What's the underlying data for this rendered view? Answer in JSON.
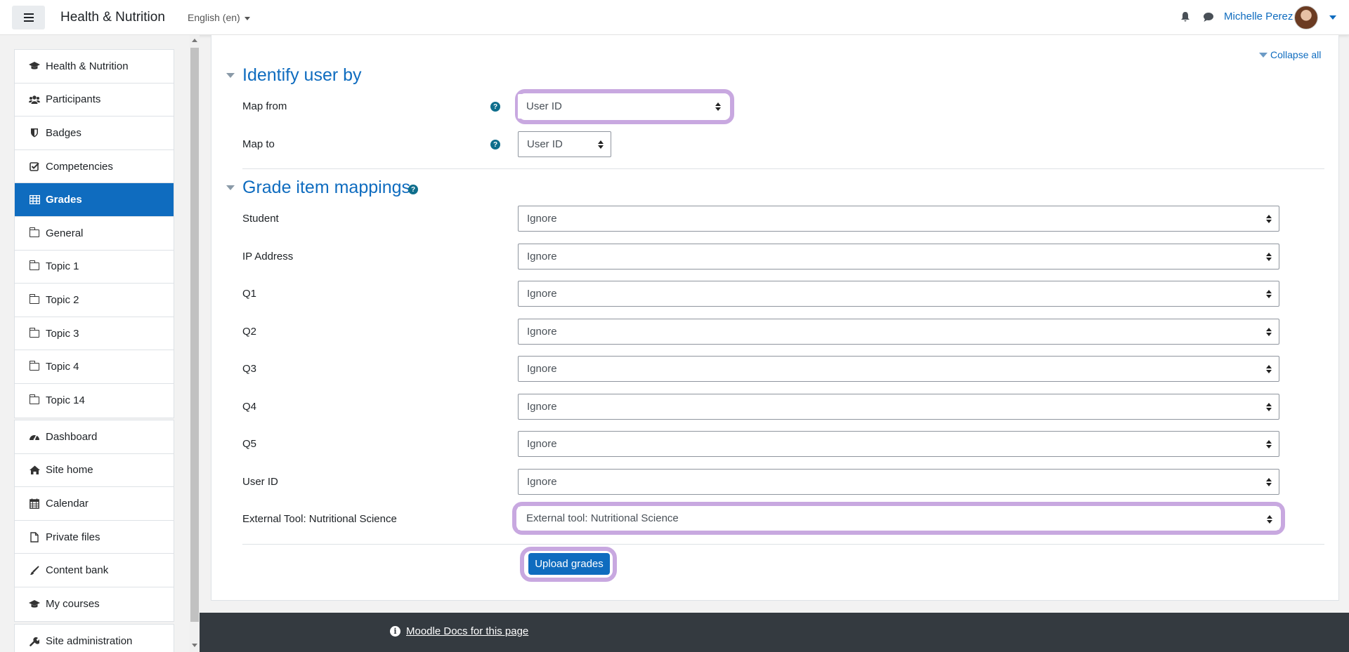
{
  "navbar": {
    "site_name": "Health & Nutrition",
    "language": "English (en)",
    "user_name": "Michelle Perez"
  },
  "sidebar": {
    "course_items": [
      {
        "label": "Health & Nutrition",
        "icon": "graduation-cap-icon"
      },
      {
        "label": "Participants",
        "icon": "users-icon"
      },
      {
        "label": "Badges",
        "icon": "shield-icon"
      },
      {
        "label": "Competencies",
        "icon": "check-square-icon"
      },
      {
        "label": "Grades",
        "icon": "table-icon",
        "active": true
      },
      {
        "label": "General",
        "icon": "folder-icon"
      },
      {
        "label": "Topic 1",
        "icon": "folder-icon"
      },
      {
        "label": "Topic 2",
        "icon": "folder-icon"
      },
      {
        "label": "Topic 3",
        "icon": "folder-icon"
      },
      {
        "label": "Topic 4",
        "icon": "folder-icon"
      },
      {
        "label": "Topic 14",
        "icon": "folder-icon"
      }
    ],
    "site_items": [
      {
        "label": "Dashboard",
        "icon": "tachometer-icon"
      },
      {
        "label": "Site home",
        "icon": "home-icon"
      },
      {
        "label": "Calendar",
        "icon": "calendar-icon"
      },
      {
        "label": "Private files",
        "icon": "file-icon"
      },
      {
        "label": "Content bank",
        "icon": "paint-brush-icon"
      },
      {
        "label": "My courses",
        "icon": "graduation-cap-icon"
      }
    ],
    "admin_items": [
      {
        "label": "Site administration",
        "icon": "wrench-icon"
      }
    ]
  },
  "main": {
    "collapse_all": "Collapse all",
    "identify_section": {
      "title": "Identify user by",
      "map_from_label": "Map from",
      "map_from_value": "User ID",
      "map_to_label": "Map to",
      "map_to_value": "User ID"
    },
    "grade_section": {
      "title": "Grade item mappings",
      "rows": [
        {
          "label": "Student",
          "value": "Ignore"
        },
        {
          "label": "IP Address",
          "value": "Ignore"
        },
        {
          "label": "Q1",
          "value": "Ignore"
        },
        {
          "label": "Q2",
          "value": "Ignore"
        },
        {
          "label": "Q3",
          "value": "Ignore"
        },
        {
          "label": "Q4",
          "value": "Ignore"
        },
        {
          "label": "Q5",
          "value": "Ignore"
        },
        {
          "label": "User ID",
          "value": "Ignore"
        },
        {
          "label": "External Tool: Nutritional Science",
          "value": "External tool: Nutritional Science"
        }
      ]
    },
    "upload_button": "Upload grades"
  },
  "footer": {
    "docs_link": "Moodle Docs for this page"
  },
  "colors": {
    "primary": "#0f6cbf",
    "highlight": "#c8a8e0",
    "footer_bg": "#343a40"
  }
}
